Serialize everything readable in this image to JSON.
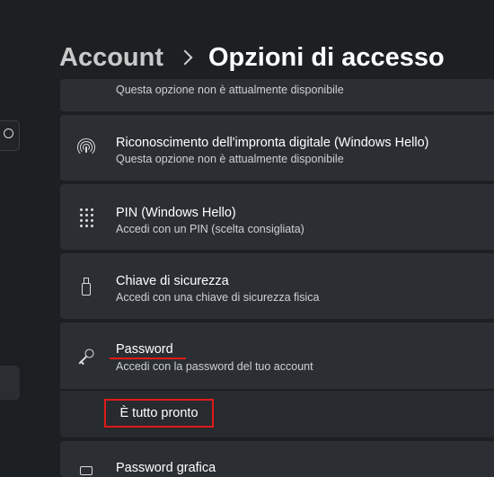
{
  "header": {
    "parent": "Account",
    "current": "Opzioni di accesso"
  },
  "options": [
    {
      "id": "face",
      "icon": "face-recognition-icon",
      "title": "",
      "subtitle": "Questa opzione non è attualmente disponibile"
    },
    {
      "id": "fingerprint",
      "icon": "fingerprint-icon",
      "title": "Riconoscimento dell'impronta digitale (Windows Hello)",
      "subtitle": "Questa opzione non è attualmente disponibile"
    },
    {
      "id": "pin",
      "icon": "keypad-icon",
      "title": "PIN (Windows Hello)",
      "subtitle": "Accedi con un PIN (scelta consigliata)"
    },
    {
      "id": "security-key",
      "icon": "usb-key-icon",
      "title": "Chiave di sicurezza",
      "subtitle": "Accedi con una chiave di sicurezza fisica"
    },
    {
      "id": "password",
      "icon": "key-icon",
      "title": "Password",
      "subtitle": "Accedi con la password del tuo account",
      "expanded": true,
      "status": "È tutto pronto"
    },
    {
      "id": "picture-password",
      "icon": "picture-password-icon",
      "title": "Password grafica",
      "subtitle": ""
    }
  ],
  "colors": {
    "background": "#1c2023",
    "card": "#2b2f33",
    "highlight": "#e01a1a"
  }
}
